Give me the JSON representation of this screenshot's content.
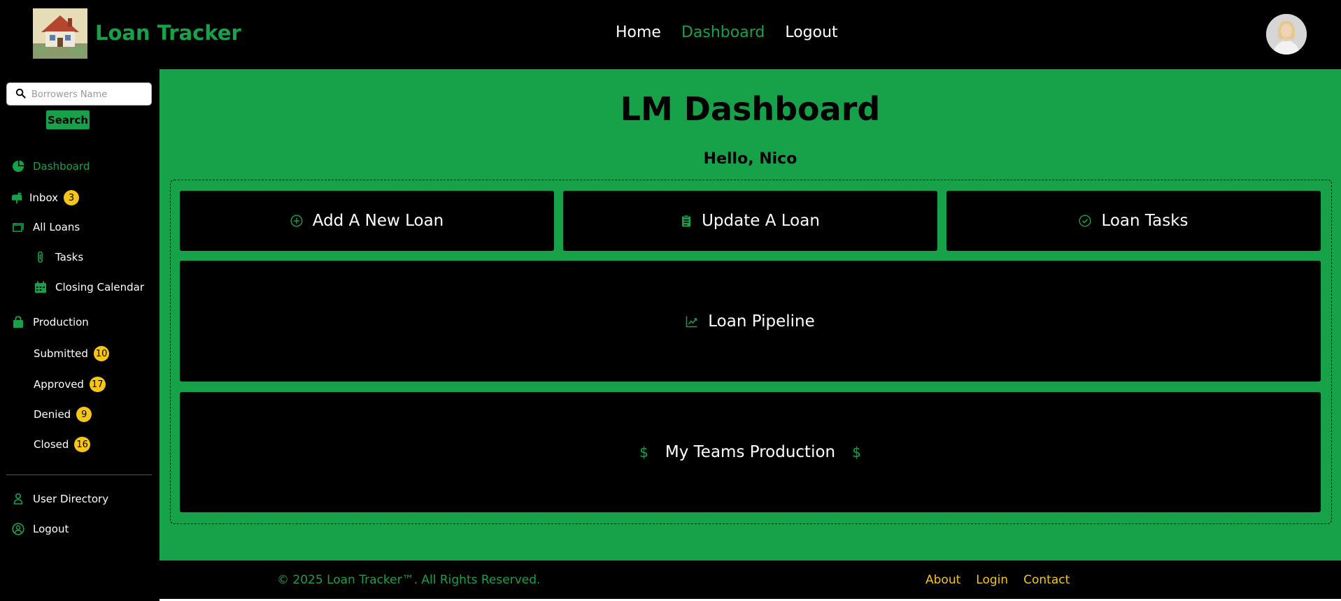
{
  "brand": {
    "title": "Loan Tracker"
  },
  "nav": {
    "home": "Home",
    "dashboard": "Dashboard",
    "logout": "Logout"
  },
  "search": {
    "placeholder": "Borrowers Name",
    "button_label": "Search"
  },
  "sidebar": {
    "dashboard": "Dashboard",
    "inbox": {
      "label": "Inbox",
      "count": "3"
    },
    "all_loans": "All Loans",
    "tasks": "Tasks",
    "closing_calendar": "Closing Calendar",
    "production": "Production",
    "submitted": {
      "label": "Submitted",
      "count": "10"
    },
    "approved": {
      "label": "Approved",
      "count": "17"
    },
    "denied": {
      "label": "Denied",
      "count": "9"
    },
    "closed": {
      "label": "Closed",
      "count": "16"
    },
    "user_directory": "User Directory",
    "logout": "Logout"
  },
  "main": {
    "title": "LM Dashboard",
    "greeting": "Hello, Nico",
    "cards": {
      "add_loan": "Add A New Loan",
      "update_loan": "Update A Loan",
      "loan_tasks": "Loan Tasks",
      "pipeline": "Loan Pipeline",
      "team_production": "My Teams Production"
    }
  },
  "footer": {
    "copyright": "© 2025 Loan Tracker™. All Rights Reserved.",
    "about": "About",
    "login": "Login",
    "contact": "Contact"
  },
  "colors": {
    "accent": "#17a24a",
    "badge": "#f5c518",
    "background": "#000000"
  }
}
